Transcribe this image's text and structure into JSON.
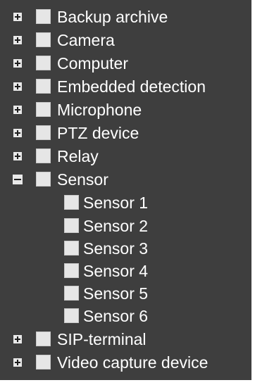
{
  "tree": {
    "items": [
      {
        "label": "Backup archive",
        "expander": "plus"
      },
      {
        "label": "Camera",
        "expander": "plus"
      },
      {
        "label": "Computer",
        "expander": "plus"
      },
      {
        "label": "Embedded detection",
        "expander": "plus"
      },
      {
        "label": "Microphone",
        "expander": "plus"
      },
      {
        "label": "PTZ device",
        "expander": "plus"
      },
      {
        "label": "Relay",
        "expander": "plus"
      },
      {
        "label": "Sensor",
        "expander": "minus",
        "children": [
          {
            "label": "Sensor 1"
          },
          {
            "label": "Sensor 2"
          },
          {
            "label": "Sensor 3"
          },
          {
            "label": "Sensor 4"
          },
          {
            "label": "Sensor 5"
          },
          {
            "label": "Sensor 6"
          }
        ]
      },
      {
        "label": "SIP-terminal",
        "expander": "plus"
      },
      {
        "label": "Video capture device",
        "expander": "plus"
      }
    ]
  },
  "colors": {
    "background": "#3e3e3e",
    "text": "#ffffff",
    "checkbox": "#e6e6e6",
    "expander": "#e9e9e9"
  }
}
